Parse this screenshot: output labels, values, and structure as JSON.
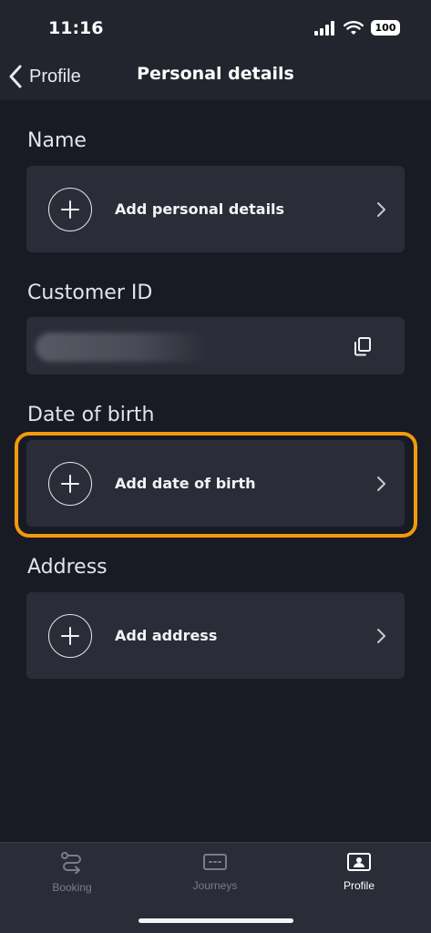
{
  "status_bar": {
    "time": "11:16",
    "battery": "100"
  },
  "header": {
    "back_label": "Profile",
    "title": "Personal details"
  },
  "sections": {
    "name": {
      "label": "Name",
      "action": "Add personal details"
    },
    "customer_id": {
      "label": "Customer ID"
    },
    "date_of_birth": {
      "label": "Date of birth",
      "action": "Add date of birth"
    },
    "address": {
      "label": "Address",
      "action": "Add address"
    }
  },
  "tabbar": {
    "tabs": [
      {
        "label": "Booking",
        "icon": "route-icon"
      },
      {
        "label": "Journeys",
        "icon": "ticket-icon"
      },
      {
        "label": "Profile",
        "icon": "profile-card-icon",
        "active": true
      }
    ]
  },
  "colors": {
    "highlight": "#f29a0d",
    "background": "#181b24",
    "card": "#2a2d37"
  }
}
